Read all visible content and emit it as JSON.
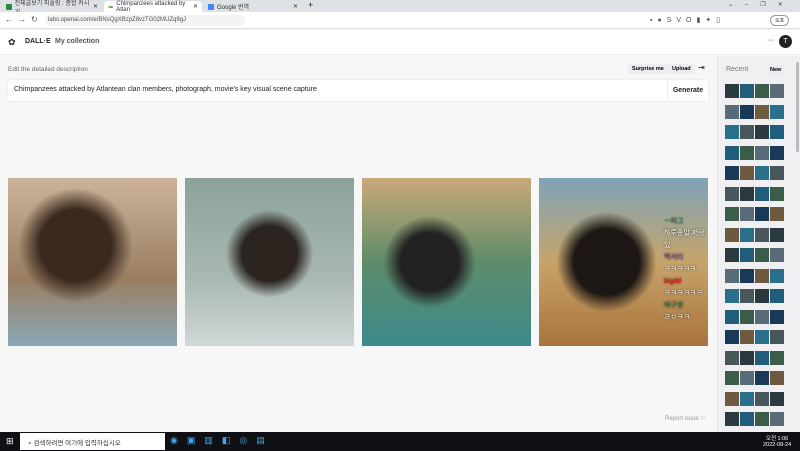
{
  "browser": {
    "tabs": [
      {
        "label": "전체글보기 피플링 : 종합 커시기",
        "active": false,
        "color": "#1e8e3e"
      },
      {
        "label": "Chimpanzees attacked by Atlan",
        "active": true,
        "color": "#9b59b6"
      },
      {
        "label": "Google 번역",
        "active": false,
        "color": "#4285f4"
      }
    ],
    "url": "labs.openai.com/e/BNsQgXBzpZ8vzTG02MUZq9gJ",
    "profile_label": "오프"
  },
  "header": {
    "logo": "DALL·E",
    "nav": "My collection",
    "more": "···",
    "avatar": "T"
  },
  "editor": {
    "label": "Edit the detailed description",
    "surprise": "Surprise me",
    "upload": "Upload",
    "prompt": "Chimpanzees attacked by Atlantean clan members, photograph, movie's key visual scene capture",
    "generate": "Generate"
  },
  "overlay_chat": [
    "ㅡ피그",
    "하루종일 저랑있",
    "백서리",
    "ㅋㅋㅋㅋㅋ",
    "bigdd",
    "ㅋㅋㅋㅋㅋㅋ",
    "메구쌍",
    "ㄹㅇㅋㅋ"
  ],
  "report": "Report issue",
  "sidebar": {
    "title": "Recent",
    "new": "New"
  },
  "taskbar": {
    "search_placeholder": "검색하려면 여기에 입력하십시오",
    "time": "오전 1:06",
    "date": "2022-08-24"
  }
}
